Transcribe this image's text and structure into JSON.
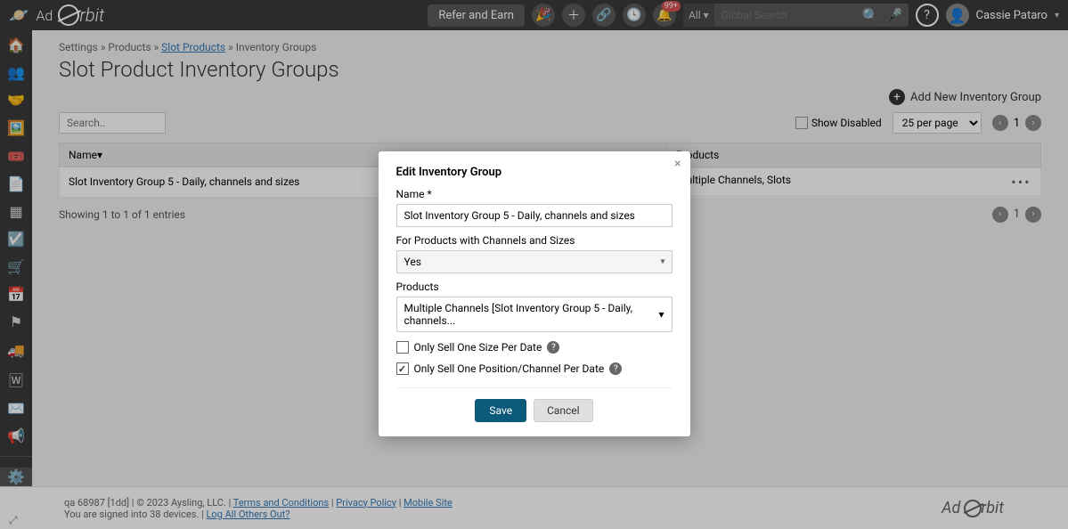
{
  "header": {
    "brand": "Ad Orbit",
    "refer_btn": "Refer and Earn",
    "notif_badge": "99+",
    "search_scope": "All",
    "search_placeholder": "Global Search",
    "user_name": "Cassie Pataro"
  },
  "breadcrumb": {
    "settings": "Settings",
    "products": "Products",
    "slot_products": "Slot Products",
    "current": "Inventory Groups",
    "sep": "»"
  },
  "page": {
    "title": "Slot Product Inventory Groups",
    "add_btn": "Add New Inventory Group",
    "search_placeholder": "Search..",
    "show_disabled": "Show Disabled",
    "per_page": "25 per page",
    "page_num": "1",
    "entries_info": "Showing 1 to 1 of 1 entries"
  },
  "table": {
    "col_name": "Name",
    "col_products": "Products",
    "row1_name": "Slot Inventory Group 5 - Daily, channels and sizes",
    "row1_products": "Multiple Channels, Slots"
  },
  "modal": {
    "title": "Edit Inventory Group",
    "name_label": "Name *",
    "name_value": "Slot Inventory Group 5 - Daily, channels and sizes",
    "for_products_label": "For Products with Channels and Sizes",
    "for_products_value": "Yes",
    "products_label": "Products",
    "products_value": "Multiple Channels [Slot Inventory Group 5 - Daily, channels...",
    "check1": "Only Sell One Size Per Date",
    "check2": "Only Sell One Position/Channel Per Date",
    "save": "Save",
    "cancel": "Cancel"
  },
  "footer": {
    "line1_a": "qa 68987 [1dd]",
    "line1_b": "© 2023 Aysling, LLC.",
    "terms": "Terms and Conditions",
    "privacy": "Privacy Policy",
    "mobile": "Mobile Site",
    "line2_a": "You are signed into 38 devices.",
    "logout": "Log All Others Out?",
    "brand": "Ad Orbit"
  }
}
